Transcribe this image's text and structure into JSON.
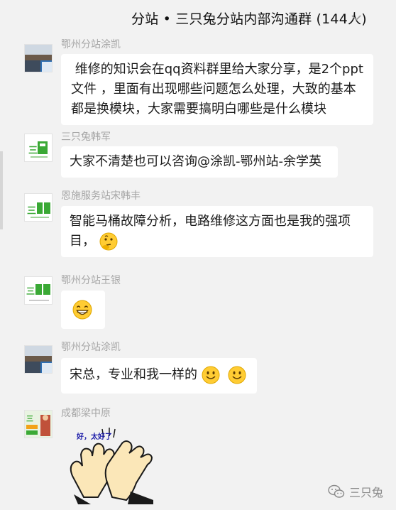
{
  "header": {
    "title": "分站 • 三只兔分站内部沟通群 (144人)",
    "expand_icon": "chevron-down-icon"
  },
  "messages": [
    {
      "sender": "鄂州分站涂凯",
      "avatar": "photo-avatar",
      "text": " 维修的知识会在qq资料群里给大家分享，是2个ppt文件 ，里面有出现哪些问题怎么处理，大致的基本都是换模块，大家需要搞明白哪些是什么模块"
    },
    {
      "sender": "三只兔韩军",
      "avatar": "sanzhitu-logo-avatar",
      "text": "大家不清楚也可以咨询@涂凯-鄂州站-余学英"
    },
    {
      "sender": "恩施服务站宋韩丰",
      "avatar": "sanzhitu-logo-avatar",
      "text": "智能马桶故障分析，电路维修这方面也是我的强项目，",
      "emoji": "thinking-emoji"
    },
    {
      "sender": "鄂州分站王银",
      "avatar": "sanzhitu-logo-avatar",
      "emoji": "grin-emoji"
    },
    {
      "sender": "鄂州分站涂凯",
      "avatar": "photo-avatar",
      "text": "宋总，专业和我一样的",
      "emoji": "smile-emoji"
    },
    {
      "sender": "成都梁中原",
      "avatar": "sanzhitu-logo-avatar",
      "sticker": "clapping-hands-sticker",
      "sticker_caption": "好，太好了"
    }
  ],
  "watermark": {
    "icon": "wechat-icon",
    "label": "三只兔"
  },
  "colors": {
    "background": "#f2f2f2",
    "bubble": "#ffffff",
    "sender": "#a6a6a6",
    "logo_green": "#3aa935"
  }
}
